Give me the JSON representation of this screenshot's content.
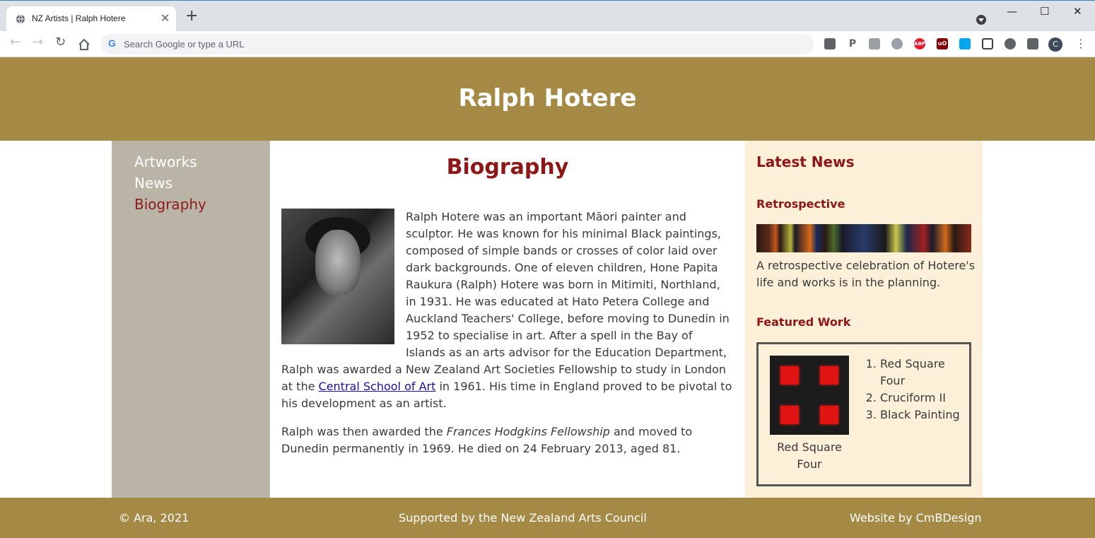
{
  "browser": {
    "tab_title": "NZ Artists | Ralph Hotere",
    "new_tab": "+",
    "omnibox_placeholder": "Search Google or type a URL",
    "avatar_letter": "C",
    "extensions": [
      "P",
      "ABP",
      "uO"
    ]
  },
  "header": {
    "title": "Ralph Hotere"
  },
  "sidebar": {
    "items": [
      {
        "label": "Artworks",
        "active": false
      },
      {
        "label": "News",
        "active": false
      },
      {
        "label": "Biography",
        "active": true
      }
    ]
  },
  "main": {
    "heading": "Biography",
    "bio_p1_before_link": "Ralph Hotere was an important Māori painter and sculptor. He was known for his minimal Black paintings, composed of simple bands or crosses of color laid over dark backgrounds. One of eleven children, Hone Papita Raukura (Ralph) Hotere was born in Mitimiti, Northland, in 1931. He was educated at Hato Petera College and Auckland Teachers' College, before moving to Dunedin in 1952 to specialise in art. After a spell in the Bay of Islands as an arts advisor for the Education Department, Ralph was awarded a New Zealand Art Societies Fellowship to study in London at the ",
    "bio_p1_link": "Central School of Art",
    "bio_p1_after_link": " in 1961. His time in England proved to be pivotal to his development as an artist.",
    "bio_p2_before": "Ralph was then awarded the ",
    "bio_p2_italic": "Frances Hodgkins Fellowship",
    "bio_p2_after": " and moved to Dunedin permanently in 1969. He died on 24 February 2013, aged 81."
  },
  "news": {
    "heading": "Latest News",
    "retro_title": "Retrospective",
    "retro_text": "A retrospective celebration of Hotere's life and works is in the planning.",
    "featured_title": "Featured Work",
    "featured_caption": "Red Square Four",
    "featured_list": [
      "Red Square Four",
      "Cruciform II",
      "Black Painting"
    ]
  },
  "footer": {
    "copyright": "© Ara, 2021",
    "supported": "Supported by the New Zealand Arts Council",
    "credit": "Website by CmBDesign"
  }
}
